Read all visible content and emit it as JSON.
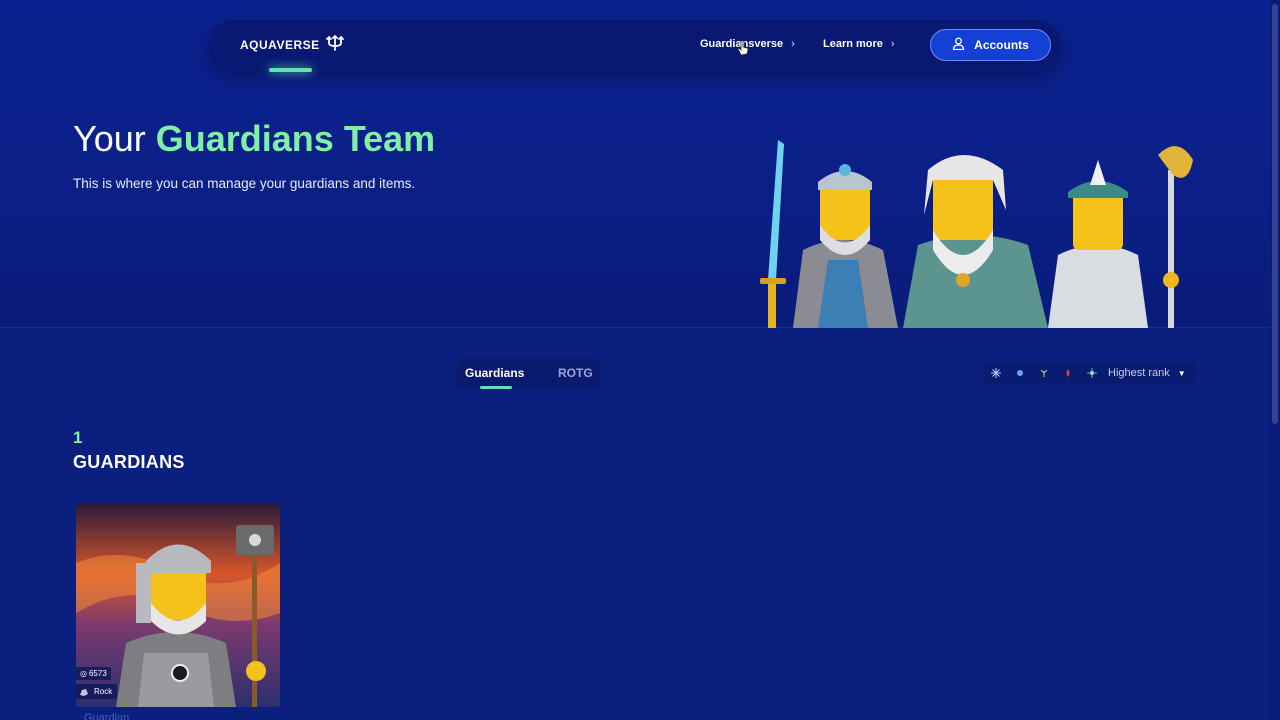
{
  "nav": {
    "logo": "AQUAVERSE",
    "links": [
      {
        "label": "Guardiansverse",
        "chevron": "›"
      },
      {
        "label": "Learn more",
        "chevron": "›"
      }
    ],
    "accounts_label": "Accounts"
  },
  "hero": {
    "title_prefix": "Your",
    "title_accent": "Guardians Team",
    "subtitle": "This is where you can manage your guardians and items."
  },
  "tabs": [
    {
      "label": "Guardians",
      "active": true
    },
    {
      "label": "ROTG",
      "active": false
    }
  ],
  "filters": {
    "elements": [
      "filter-icon-1",
      "filter-icon-2",
      "filter-icon-3",
      "filter-icon-4",
      "filter-icon-5"
    ],
    "sort_label": "Highest rank"
  },
  "collection": {
    "count": "1",
    "label": "GUARDIANS"
  },
  "card": {
    "rank": "6573",
    "type": "Rock",
    "caption": "Guardian"
  },
  "colors": {
    "background": "#0a1f82",
    "accent_green": "#7ff0a6",
    "button_blue": "#1440d6"
  }
}
